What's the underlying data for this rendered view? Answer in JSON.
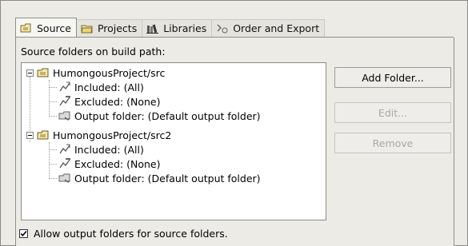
{
  "tabs": [
    {
      "label": "Source",
      "icon": "source-folder-icon",
      "active": true
    },
    {
      "label": "Projects",
      "icon": "projects-folder-icon",
      "active": false
    },
    {
      "label": "Libraries",
      "icon": "libraries-icon",
      "active": false
    },
    {
      "label": "Order and Export",
      "icon": "order-export-icon",
      "active": false
    }
  ],
  "caption": "Source folders on build path:",
  "tree": {
    "folders": [
      {
        "label": "HumongousProject/src",
        "children": [
          {
            "label": "Included: (All)",
            "icon": "included-icon"
          },
          {
            "label": "Excluded: (None)",
            "icon": "excluded-icon"
          },
          {
            "label": "Output folder: (Default output folder)",
            "icon": "output-folder-icon"
          }
        ]
      },
      {
        "label": "HumongousProject/src2",
        "children": [
          {
            "label": "Included: (All)",
            "icon": "included-icon"
          },
          {
            "label": "Excluded: (None)",
            "icon": "excluded-icon"
          },
          {
            "label": "Output folder: (Default output folder)",
            "icon": "output-folder-icon"
          }
        ]
      }
    ]
  },
  "buttons": {
    "add_folder": "Add Folder...",
    "edit": "Edit...",
    "remove": "Remove"
  },
  "checkbox": {
    "label": "Allow output folders for source folders.",
    "checked": true
  }
}
